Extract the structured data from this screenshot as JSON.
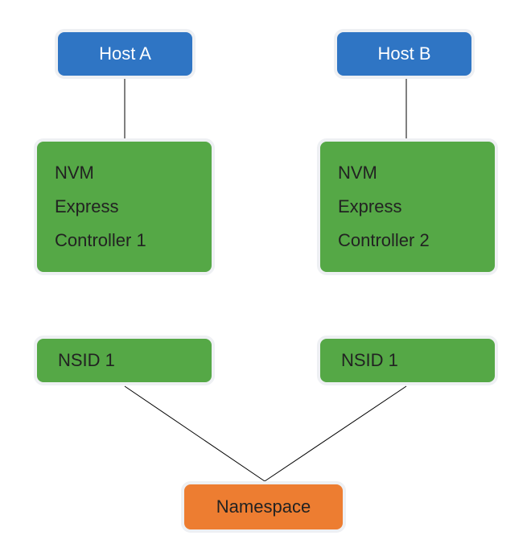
{
  "hostA": {
    "label": "Host A"
  },
  "hostB": {
    "label": "Host B"
  },
  "ctrl1": {
    "line1": "NVM",
    "line2": "Express",
    "line3": "Controller 1"
  },
  "ctrl2": {
    "line1": "NVM",
    "line2": "Express",
    "line3": "Controller 2"
  },
  "nsid1": {
    "label": "NSID 1"
  },
  "nsid2": {
    "label": "NSID 1"
  },
  "namespace": {
    "label": "Namespace"
  }
}
